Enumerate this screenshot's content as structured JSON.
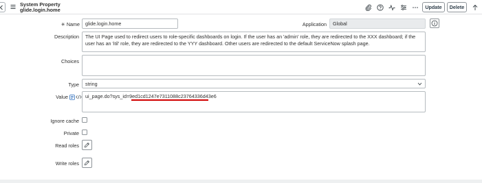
{
  "header": {
    "title": "System Property",
    "subtitle": "glide.login.home",
    "update_label": "Update",
    "delete_label": "Delete",
    "icons": [
      "paperclip-icon",
      "help-icon",
      "activity-icon",
      "settings-sliders-icon",
      "more-icon",
      "arrow-up-icon"
    ]
  },
  "form": {
    "name_label": "Name",
    "name_required_mark": "✳",
    "name_value": "glide.login.home",
    "application_label": "Application",
    "application_value": "Global",
    "description_label": "Description",
    "description_value": "The UI Page used to redirect users to role-specific dashboards on login. If the user has an 'admin' role, they are redirected to the XXX dashboard; if the user has an 'itil' role, they are redirected to the YYY dashboard. Other users are redirected to the default ServiceNow splash page.",
    "choices_label": "Choices",
    "choices_value": "",
    "type_label": "Type",
    "type_value": "string",
    "value_label": "Value",
    "value_value": "ui_page.do?sys_id=9ed1cd1247e7311088c23764336d43e6",
    "ignore_cache_label": "Ignore cache",
    "private_label": "Private",
    "read_roles_label": "Read roles",
    "write_roles_label": "Write roles"
  },
  "colors": {
    "accent_underline": "#d10000",
    "button_border": "#8e9499"
  }
}
